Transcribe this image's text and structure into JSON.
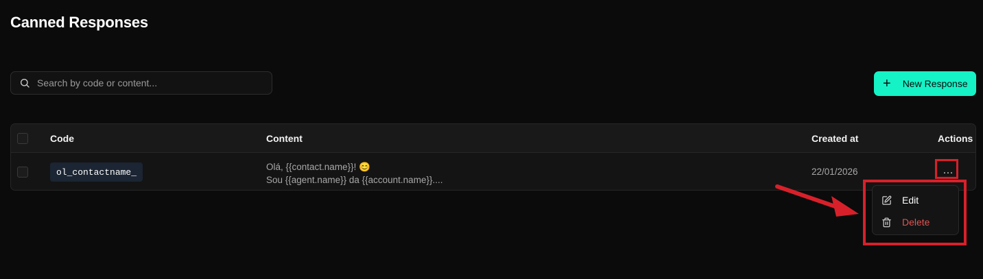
{
  "page": {
    "title": "Canned Responses"
  },
  "search": {
    "placeholder": "Search by code or content..."
  },
  "toolbar": {
    "new_label": "New Response"
  },
  "table": {
    "headers": {
      "code": "Code",
      "content": "Content",
      "created": "Created at",
      "actions": "Actions"
    },
    "rows": [
      {
        "code": "ol_contactname_",
        "content_line1": "Olá, {{contact.name}}! 😊",
        "content_line2": "Sou {{agent.name}} da {{account.name}}....",
        "created": "22/01/2026",
        "actions_label": "···"
      }
    ]
  },
  "menu": {
    "edit_label": "Edit",
    "delete_label": "Delete"
  },
  "colors": {
    "accent": "#15f2c6",
    "annotation": "#d8202a",
    "danger": "#e55353",
    "background": "#0b0b0b"
  },
  "icons": {
    "search": "search-icon",
    "plus": "plus-icon",
    "edit": "edit-icon",
    "delete": "trash-icon",
    "more": "more-horizontal-icon"
  }
}
